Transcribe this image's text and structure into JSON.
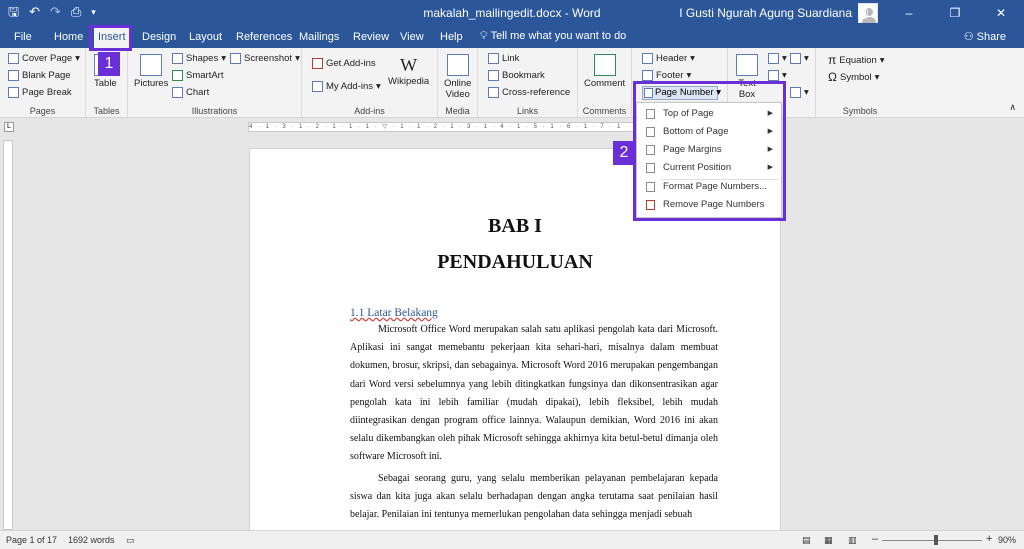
{
  "titlebar": {
    "doc_title": "makalah_mailingedit.docx - Word",
    "user": "I Gusti Ngurah Agung Suardiana",
    "qat": {
      "save_icon": "save-icon",
      "undo_icon": "undo-icon",
      "redo_icon": "redo-icon",
      "preview_icon": "print-preview-icon",
      "customize_icon": "customize-qat-icon"
    },
    "window_controls": {
      "restore_ribbon": "▣",
      "minimize": "–",
      "maximize": "❐",
      "close": "✕"
    }
  },
  "tabs": [
    {
      "label": "File"
    },
    {
      "label": "Home"
    },
    {
      "label": "Insert",
      "active": true
    },
    {
      "label": "Design"
    },
    {
      "label": "Layout"
    },
    {
      "label": "References"
    },
    {
      "label": "Mailings"
    },
    {
      "label": "Review"
    },
    {
      "label": "View"
    },
    {
      "label": "Help"
    }
  ],
  "tell_me": "Tell me what you want to do",
  "share": "Share",
  "ribbon": {
    "pages": {
      "label": "Pages",
      "cover_page": "Cover Page",
      "blank_page": "Blank Page",
      "page_break": "Page Break"
    },
    "tables": {
      "label": "Tables",
      "table": "Table"
    },
    "illustrations": {
      "label": "Illustrations",
      "pictures": "Pictures",
      "shapes": "Shapes",
      "smartart": "SmartArt",
      "chart": "Chart",
      "screenshot": "Screenshot"
    },
    "addins": {
      "label": "Add-ins",
      "get_addins": "Get Add-ins",
      "my_addins": "My Add-ins",
      "wikipedia": "Wikipedia"
    },
    "media": {
      "label": "Media",
      "online_video_1": "Online",
      "online_video_2": "Video"
    },
    "links": {
      "label": "Links",
      "link": "Link",
      "bookmark": "Bookmark",
      "cross_reference": "Cross-reference"
    },
    "comments": {
      "label": "Comments",
      "comment": "Comment"
    },
    "header_footer": {
      "header": "Header",
      "footer": "Footer",
      "page_number": "Page Number"
    },
    "text": {
      "text_box_1": "Text",
      "text_box_2": "Box"
    },
    "symbols": {
      "label": "Symbols",
      "equation": "Equation",
      "symbol": "Symbol"
    }
  },
  "page_number_menu": [
    {
      "label": "Top of Page",
      "submenu": true
    },
    {
      "label": "Bottom of Page",
      "submenu": true
    },
    {
      "label": "Page Margins",
      "submenu": true
    },
    {
      "label": "Current Position",
      "submenu": true
    },
    {
      "label": "Format Page Numbers...",
      "submenu": false
    },
    {
      "label": "Remove Page Numbers",
      "submenu": false
    }
  ],
  "annotations": {
    "step1": "1",
    "step2": "2",
    "color": "#6a2fd6"
  },
  "ruler": "4 · 1 · 3 · 1 · 2 · 1 · 1 · 1 · ▽ · 1 · 1 · 2 · 1 · 3 · 1 · 4 · 1 · 5 · 1 · 6 · 1 · 7 · 1 · 8 · 1 · 9 · 1 · 10 · 1 · 11",
  "document": {
    "heading1": "BAB I",
    "heading2": "PENDAHULUAN",
    "subheading": "1.1 Latar Belakang",
    "para1": "Microsoft Office Word merupakan salah satu aplikasi pengolah kata dari Microsoft. Aplikasi ini sangat memebantu pekerjaan kita sehari-hari, misalnya dalam membuat dokumen, brosur, skripsi, dan sebagainya. Microsoft Word 2016 merupakan pengembangan dari Word versi sebelumnya yang lebih ditingkatkan fungsinya dan dikonsentrasikan agar pengolah kata ini lebih familiar (mudah dipakai), lebih fleksibel, lebih mudah diintegrasikan dengan program office lainnya. Walaupun demikian, Word 2016 ini akan selalu dikembangkan oleh pihak Microsoft sehingga akhirnya kita betul-betul dimanja oleh software Microsoft ini.",
    "para2": "Sebagai seorang guru, yang selalu memberikan pelayanan pembelajaran kepada siswa dan kita juga akan selalu berhadapan dengan angka terutama saat penilaian hasil belajar. Penilaian ini tentunya memerlukan pengolahan data sehingga menjadi sebuah"
  },
  "statusbar": {
    "page": "Page 1 of 17",
    "words": "1692 words",
    "zoom_minus": "–",
    "zoom_plus": "+",
    "zoom": "90%"
  }
}
